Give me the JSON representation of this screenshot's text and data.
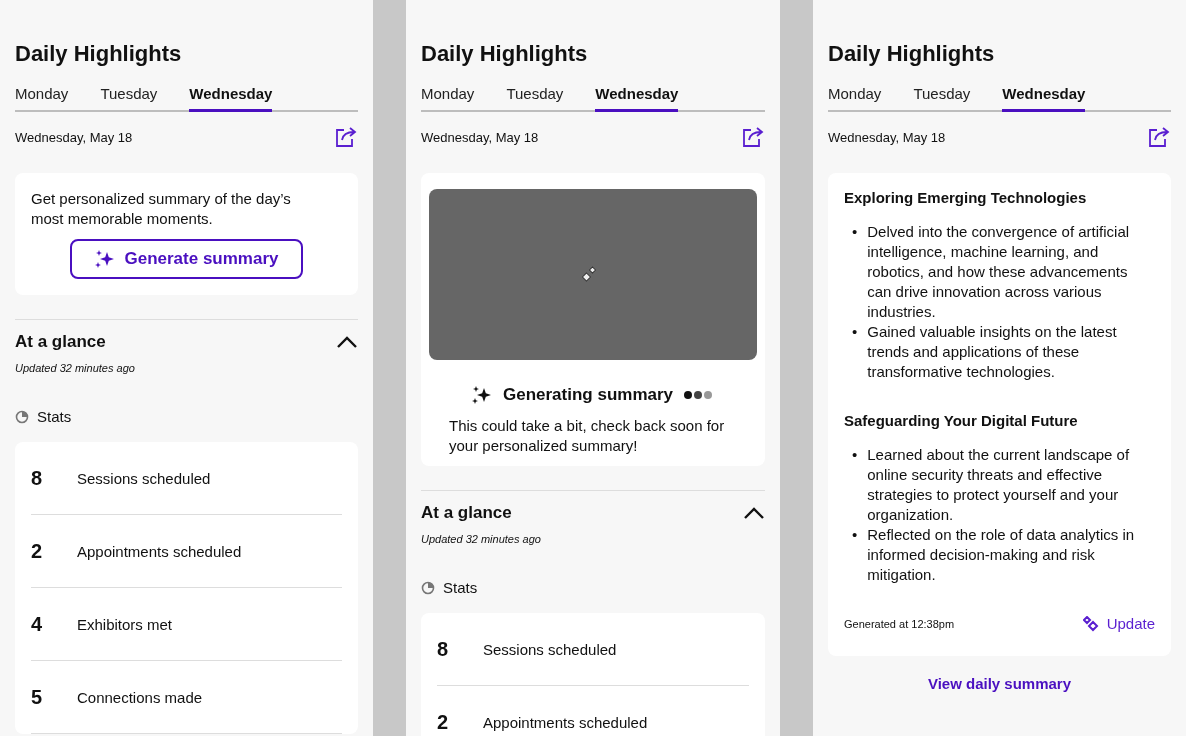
{
  "panels": [
    {
      "title": "Daily Highlights",
      "tabs": [
        {
          "label": "Monday",
          "selected": false
        },
        {
          "label": "Tuesday",
          "selected": false
        },
        {
          "label": "Wednesday",
          "selected": true
        }
      ],
      "date": "Wednesday, May 18",
      "summary": {
        "kind": "prompt",
        "text": "Get personalized summary of the day’s most memorable moments.",
        "button": "Generate summary"
      },
      "glance": {
        "title": "At a glance",
        "updated": "Updated 32 minutes ago",
        "stats_label": "Stats",
        "stats": [
          {
            "value": "8",
            "label": "Sessions scheduled"
          },
          {
            "value": "2",
            "label": "Appointments scheduled"
          },
          {
            "value": "4",
            "label": "Exhibitors met"
          },
          {
            "value": "5",
            "label": "Connections made"
          }
        ]
      }
    },
    {
      "title": "Daily Highlights",
      "tabs": [
        {
          "label": "Monday",
          "selected": false
        },
        {
          "label": "Tuesday",
          "selected": false
        },
        {
          "label": "Wednesday",
          "selected": true
        }
      ],
      "date": "Wednesday, May 18",
      "summary": {
        "kind": "generating",
        "status": "Generating summary",
        "text": "This could take a bit, check back soon for your personalized summary!"
      },
      "glance": {
        "title": "At a glance",
        "updated": "Updated 32 minutes ago",
        "stats_label": "Stats",
        "stats": [
          {
            "value": "8",
            "label": "Sessions scheduled"
          },
          {
            "value": "2",
            "label": "Appointments scheduled"
          }
        ]
      }
    },
    {
      "title": "Daily Highlights",
      "tabs": [
        {
          "label": "Monday",
          "selected": false
        },
        {
          "label": "Tuesday",
          "selected": false
        },
        {
          "label": "Wednesday",
          "selected": true
        }
      ],
      "date": "Wednesday, May 18",
      "summary": {
        "kind": "result",
        "sections": [
          {
            "heading": "Exploring Emerging Technologies",
            "bullets": [
              {
                "marker": "•",
                "text": "Delved into the convergence of artificial intelligence, machine learning, and robotics, and how these advancements can drive innovation across various industries."
              },
              {
                "marker": "•",
                "text": "Gained valuable insights on the latest trends and applications of these transformative technologies."
              }
            ]
          },
          {
            "heading": "Safeguarding Your Digital Future",
            "bullets": [
              {
                "marker": "•",
                "text": "Learned about the current landscape of online security threats and effective strategies to protect yourself and your organization."
              },
              {
                "marker": "•",
                "text": "Reflected on the role of data analytics in informed decision-making and risk mitigation."
              }
            ]
          }
        ],
        "generated": "Generated at 12:38pm",
        "update": "Update"
      },
      "link": "View daily summary"
    }
  ]
}
